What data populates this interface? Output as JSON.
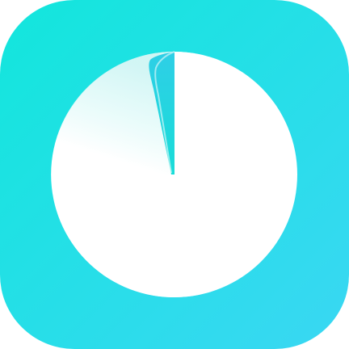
{
  "app_icon": {
    "name": "timer-app-icon",
    "icon": "pie-timer-icon",
    "colors": {
      "background_start": "#12E6DC",
      "background_end": "#3AD7F3",
      "dial": "#FFFFFF",
      "fold_highlight": "#CFF5F4",
      "notch": "#2ECFE6"
    }
  }
}
